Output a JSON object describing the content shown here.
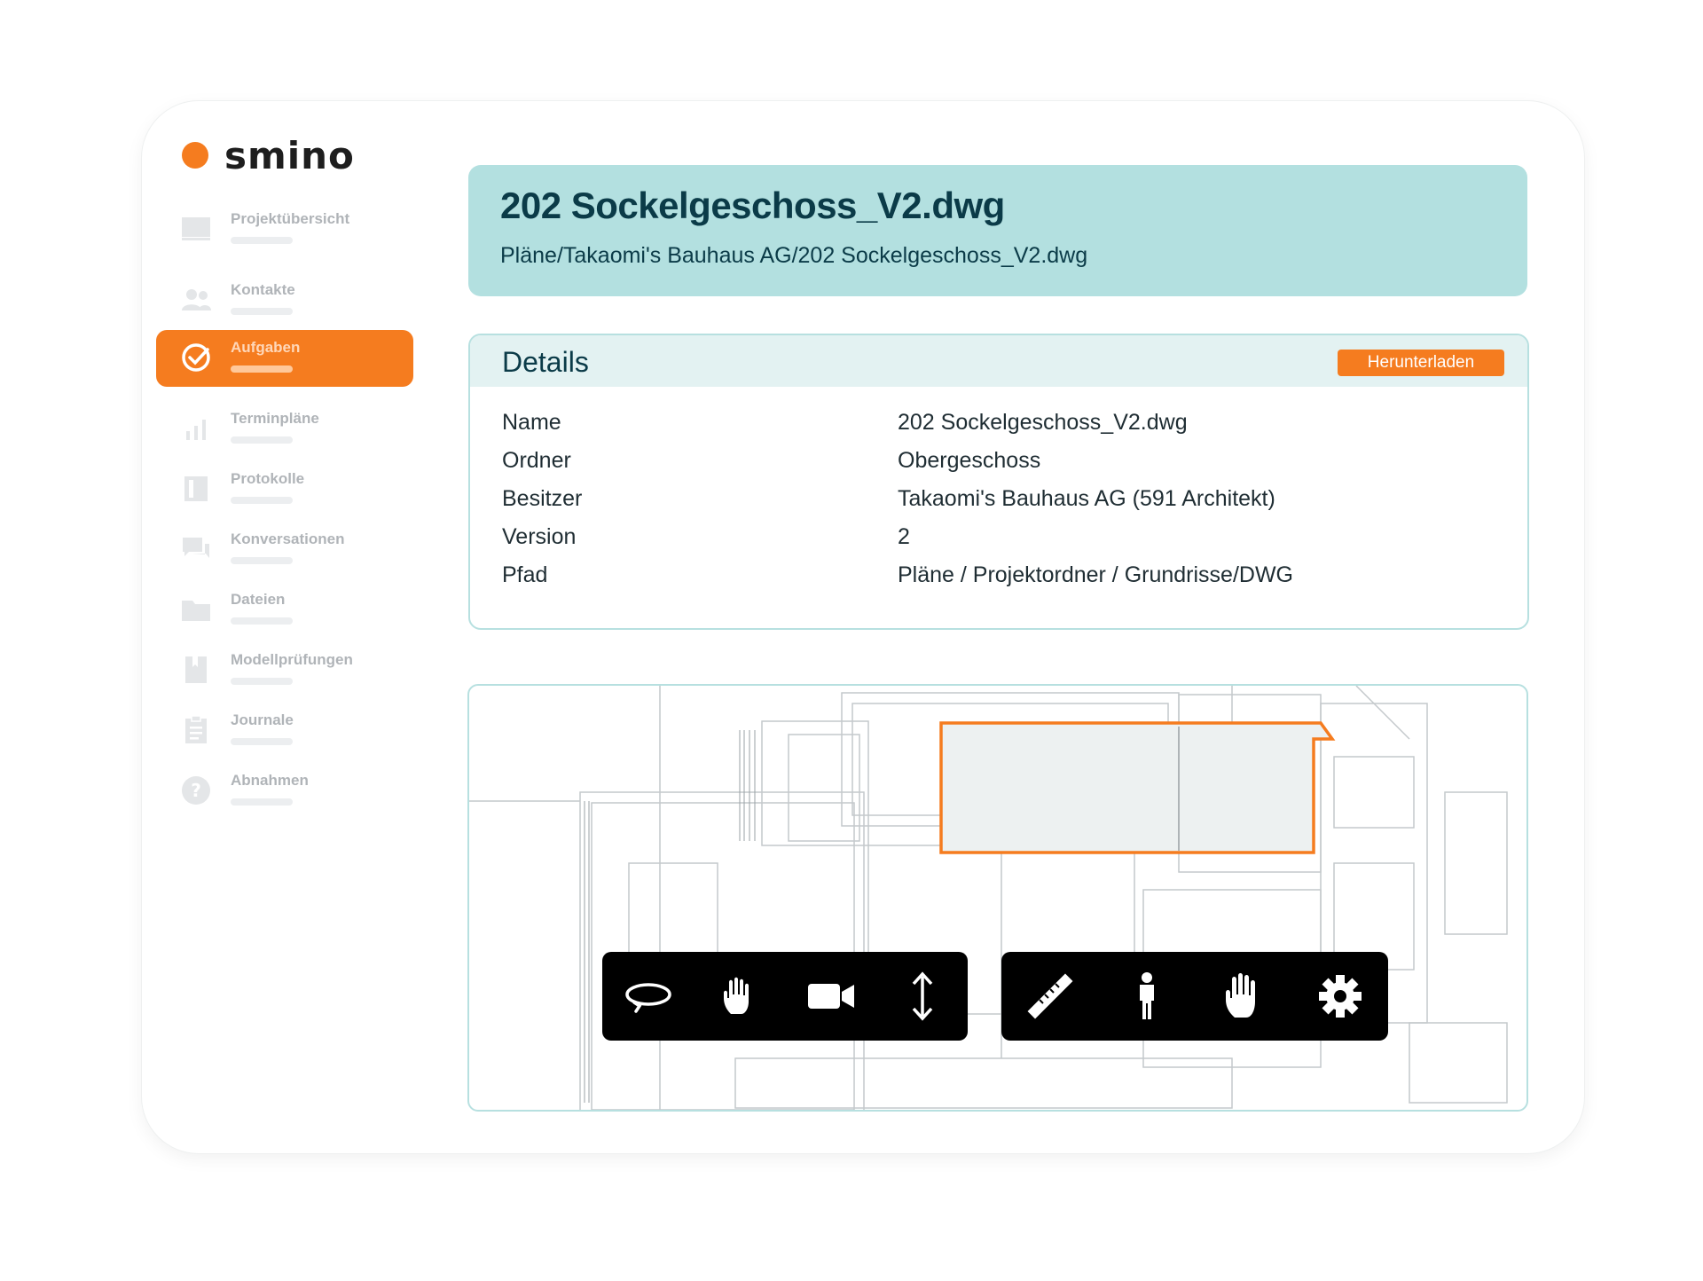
{
  "brand": {
    "name": "smino",
    "accent": "#f57c1f"
  },
  "sidebar": {
    "items": [
      {
        "label": "Projektübersicht",
        "icon": "monitor-icon"
      },
      {
        "label": "Kontakte",
        "icon": "users-icon"
      },
      {
        "label": "Aufgaben",
        "icon": "check-circle-icon",
        "active": true
      },
      {
        "label": "Terminpläne",
        "icon": "bar-chart-icon"
      },
      {
        "label": "Protokolle",
        "icon": "book-icon"
      },
      {
        "label": "Konversationen",
        "icon": "chat-icon"
      },
      {
        "label": "Dateien",
        "icon": "folder-icon"
      },
      {
        "label": "Modellprüfungen",
        "icon": "bookmark-icon"
      },
      {
        "label": "Journale",
        "icon": "clipboard-icon"
      },
      {
        "label": "Abnahmen",
        "icon": "help-circle-icon"
      }
    ]
  },
  "file": {
    "title": "202 Sockelgeschoss_V2.dwg",
    "path": "Pläne/Takaomi's Bauhaus AG/202 Sockelgeschoss_V2.dwg"
  },
  "details": {
    "heading": "Details",
    "download_label": "Herunterladen",
    "rows": [
      {
        "key": "Name",
        "value": "202 Sockelgeschoss_V2.dwg"
      },
      {
        "key": "Ordner",
        "value": "Obergeschoss"
      },
      {
        "key": "Besitzer",
        "value": "Takaomi's Bauhaus AG (591 Architekt)"
      },
      {
        "key": "Version",
        "value": "2"
      },
      {
        "key": "Pfad",
        "value": "Pläne / Projektordner / Grundrisse/DWG"
      }
    ]
  },
  "viewer": {
    "toolbar_left": [
      "orbit-icon",
      "pan-hand-icon",
      "camera-icon",
      "vertical-move-icon"
    ],
    "toolbar_right": [
      "ruler-icon",
      "person-icon",
      "hand-icon",
      "settings-icon"
    ],
    "highlight_color": "#f57c1f"
  }
}
